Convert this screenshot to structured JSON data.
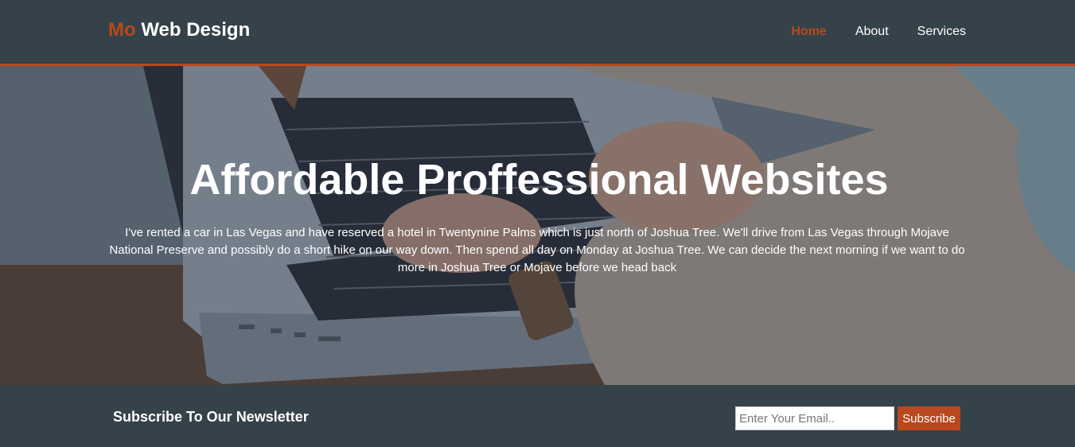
{
  "header": {
    "brand_accent": "Mo",
    "brand_rest": " Web Design",
    "nav": [
      {
        "label": "Home",
        "active": true
      },
      {
        "label": "About",
        "active": false
      },
      {
        "label": "Services",
        "active": false
      }
    ]
  },
  "showcase": {
    "title": "Affordable Proffessional Websites",
    "text": "I've rented a car in Las Vegas and have reserved a hotel in Twentynine Palms which is just north of Joshua Tree. We'll drive from Las Vegas through Mojave National Preserve and possibly do a short hike on our way down. Then spend all day on Monday at Joshua Tree. We can decide the next morning if we want to do more in Joshua Tree or Mojave before we head back"
  },
  "newsletter": {
    "heading": "Subscribe To Our Newsletter",
    "email_placeholder": "Enter Your Email..",
    "email_value": "",
    "button_label": "Subscribe"
  },
  "colors": {
    "header_bg": "#35424a",
    "accent": "#b9481e",
    "text": "#ffffff"
  }
}
